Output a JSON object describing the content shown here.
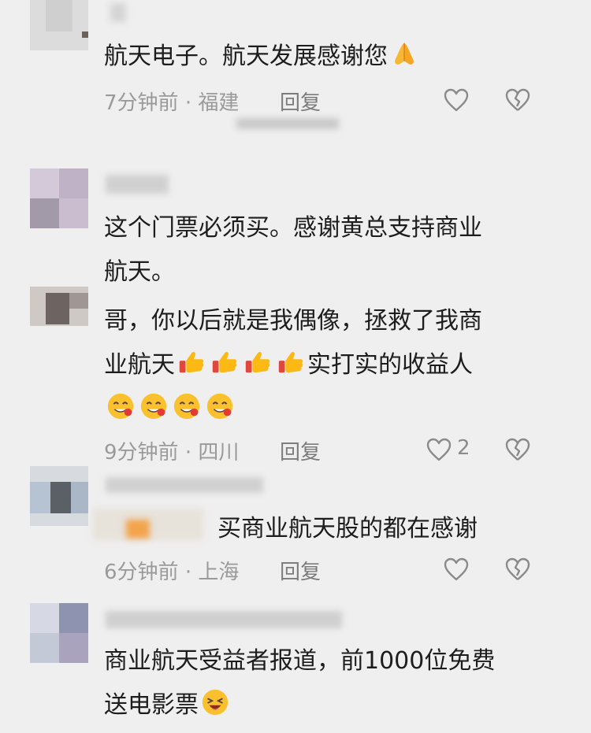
{
  "comments": [
    {
      "text_lines": [
        "航天电子。航天发展感谢您"
      ],
      "emoji_tail": "folded-hands",
      "time": "7分钟前",
      "location": "福建",
      "reply": "回复",
      "like_count": ""
    },
    {
      "text_lines": [
        "这个门票必须买。感谢黄总支持商业",
        "航天。"
      ]
    },
    {
      "text_lines": [
        "哥，你以后就是我偶像，拯救了我商",
        "业航天",
        "实打实的收益人"
      ],
      "time": "9分钟前",
      "location": "四川",
      "reply": "回复",
      "like_count": "2"
    },
    {
      "text_lines": [
        "买商业航天股的都在感谢"
      ],
      "time": "6分钟前",
      "location": "上海",
      "reply": "回复",
      "like_count": ""
    },
    {
      "text_lines": [
        "商业航天受益者报道，前1000位免费",
        "送电影票"
      ]
    }
  ],
  "separator": "·",
  "colors": {
    "background": "#efefef",
    "text": "#1d1d1d",
    "meta": "#9a9a9a",
    "icon": "#8a8a8a"
  }
}
